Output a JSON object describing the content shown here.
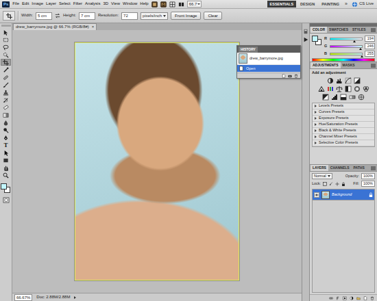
{
  "app": {
    "logo": "Ps"
  },
  "menu": [
    "File",
    "Edit",
    "Image",
    "Layer",
    "Select",
    "Filter",
    "Analysis",
    "3D",
    "View",
    "Window",
    "Help"
  ],
  "app_bar": {
    "zoom": "66.7",
    "workspaces": [
      {
        "label": "ESSENTIALS",
        "selected": true
      },
      {
        "label": "DESIGN",
        "selected": false
      },
      {
        "label": "PAINTING",
        "selected": false
      }
    ],
    "more": "»",
    "cs_live": "CS Live"
  },
  "options": {
    "width_label": "Width:",
    "width": "5 cm",
    "height_label": "Height:",
    "height": "7 cm",
    "resolution_label": "Resolution:",
    "resolution": "72",
    "units": "pixels/inch",
    "buttons": [
      "Front Image",
      "Clear"
    ]
  },
  "toolbar": {
    "tools": [
      {
        "kind": "move",
        "selected": false
      },
      {
        "kind": "marquee",
        "selected": false
      },
      {
        "kind": "lasso",
        "selected": false
      },
      {
        "kind": "quickselect",
        "selected": false
      },
      {
        "kind": "crop",
        "selected": true
      },
      {
        "kind": "eyedropper",
        "selected": false
      },
      {
        "kind": "healing",
        "selected": false
      },
      {
        "kind": "brush",
        "selected": false
      },
      {
        "kind": "stamp",
        "selected": false
      },
      {
        "kind": "historybrush",
        "selected": false
      },
      {
        "kind": "eraser",
        "selected": false
      },
      {
        "kind": "gradient",
        "selected": false
      },
      {
        "kind": "blur",
        "selected": false
      },
      {
        "kind": "dodge",
        "selected": false
      },
      {
        "kind": "pen",
        "selected": false
      },
      {
        "kind": "type",
        "glyph": "T",
        "selected": false
      },
      {
        "kind": "pathselect",
        "selected": false
      },
      {
        "kind": "shape",
        "selected": false
      },
      {
        "kind": "hand",
        "selected": false
      },
      {
        "kind": "zoom",
        "selected": false
      }
    ],
    "foreground": "#c2f6ff",
    "background": "#ffffff"
  },
  "document": {
    "tab": "drew_barrymore.jpg @ 66.7% (RGB/8#)",
    "close": "×"
  },
  "history": {
    "title": "HISTORY",
    "items": [
      {
        "label": "drew_barrymore.jpg",
        "kind": "snapshot",
        "selected": false
      },
      {
        "label": "Open",
        "kind": "step",
        "selected": true
      }
    ]
  },
  "color_panel": {
    "tabs": [
      {
        "label": "COLOR",
        "selected": true
      },
      {
        "label": "SWATCHES",
        "selected": false
      },
      {
        "label": "STYLES",
        "selected": false
      }
    ],
    "channels": [
      {
        "name": "R",
        "value": "194",
        "level": 0.761
      },
      {
        "name": "G",
        "value": "246",
        "level": 0.965
      },
      {
        "name": "B",
        "value": "255",
        "level": 1
      }
    ]
  },
  "adjustments": {
    "tabs": [
      {
        "label": "ADJUSTMENTS",
        "selected": true
      },
      {
        "label": "MASKS",
        "selected": false
      }
    ],
    "heading": "Add an adjustment",
    "presets": [
      "Levels Presets",
      "Curves Presets",
      "Exposure Presets",
      "Hue/Saturation Presets",
      "Black & White Presets",
      "Channel Mixer Presets",
      "Selective Color Presets"
    ]
  },
  "layers": {
    "tabs": [
      {
        "label": "LAYERS",
        "selected": true
      },
      {
        "label": "CHANNELS",
        "selected": false
      },
      {
        "label": "PATHS",
        "selected": false
      }
    ],
    "blend_mode": "Normal",
    "opacity_label": "Opacity:",
    "opacity": "100%",
    "lock_label": "Lock:",
    "fill_label": "Fill:",
    "fill": "100%",
    "items": [
      {
        "name": "Background",
        "selected": true,
        "visible": true,
        "locked": true
      }
    ]
  },
  "status_bar": {
    "zoom": "66.67%",
    "doc": "Doc: 2.88M/2.88M"
  }
}
